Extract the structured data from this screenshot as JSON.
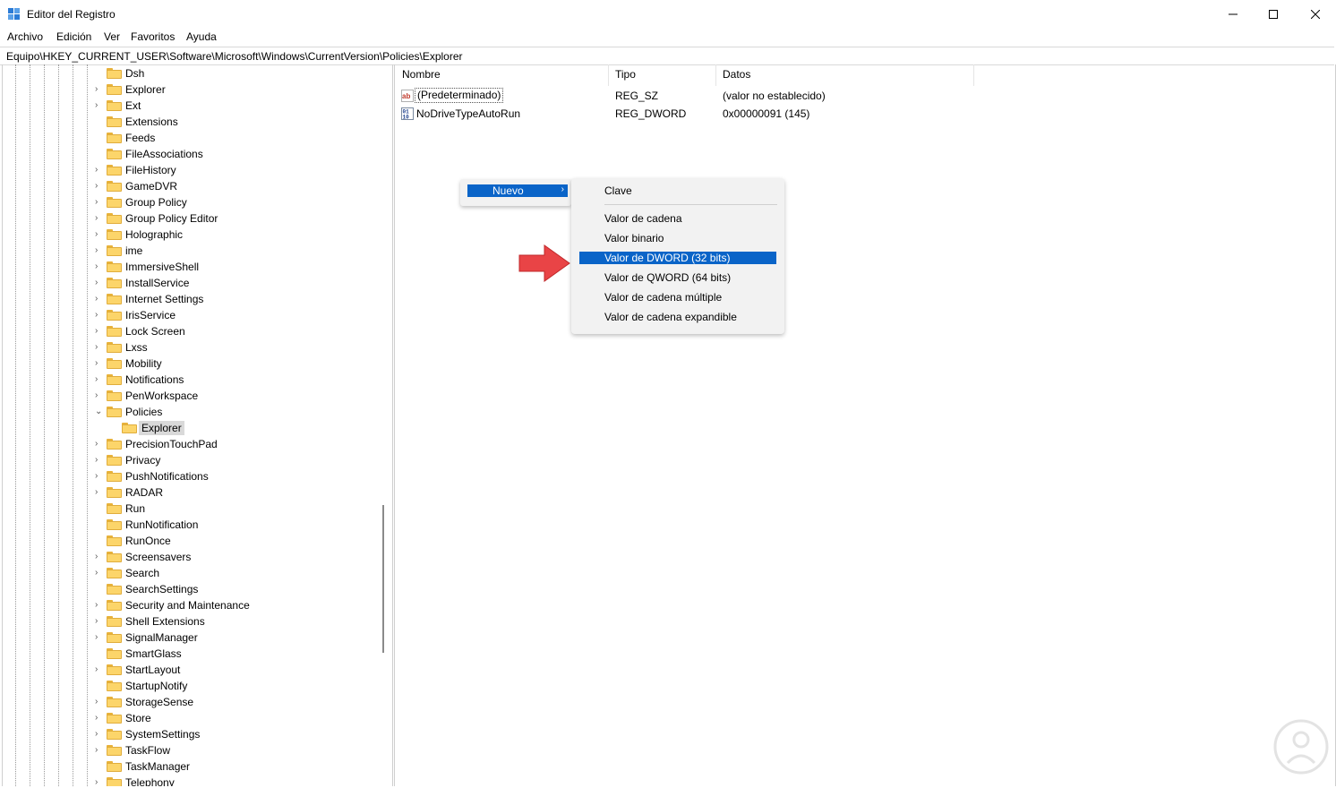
{
  "window": {
    "title": "Editor del Registro",
    "minimize": "—",
    "maximize": "☐",
    "close": "✕"
  },
  "menu": [
    "Archivo",
    "Edición",
    "Ver",
    "Favoritos",
    "Ayuda"
  ],
  "address": "Equipo\\HKEY_CURRENT_USER\\Software\\Microsoft\\Windows\\CurrentVersion\\Policies\\Explorer",
  "tree": [
    {
      "label": "Dsh",
      "expander": ""
    },
    {
      "label": "Explorer",
      "expander": "›"
    },
    {
      "label": "Ext",
      "expander": "›"
    },
    {
      "label": "Extensions",
      "expander": ""
    },
    {
      "label": "Feeds",
      "expander": ""
    },
    {
      "label": "FileAssociations",
      "expander": ""
    },
    {
      "label": "FileHistory",
      "expander": "›"
    },
    {
      "label": "GameDVR",
      "expander": "›"
    },
    {
      "label": "Group Policy",
      "expander": "›"
    },
    {
      "label": "Group Policy Editor",
      "expander": "›"
    },
    {
      "label": "Holographic",
      "expander": "›"
    },
    {
      "label": "ime",
      "expander": "›"
    },
    {
      "label": "ImmersiveShell",
      "expander": "›"
    },
    {
      "label": "InstallService",
      "expander": "›"
    },
    {
      "label": "Internet Settings",
      "expander": "›"
    },
    {
      "label": "IrisService",
      "expander": "›"
    },
    {
      "label": "Lock Screen",
      "expander": "›"
    },
    {
      "label": "Lxss",
      "expander": "›"
    },
    {
      "label": "Mobility",
      "expander": "›"
    },
    {
      "label": "Notifications",
      "expander": "›"
    },
    {
      "label": "PenWorkspace",
      "expander": "›"
    },
    {
      "label": "Policies",
      "expander": "⌄"
    },
    {
      "label": "Explorer",
      "expander": "",
      "child": true
    },
    {
      "label": "PrecisionTouchPad",
      "expander": "›"
    },
    {
      "label": "Privacy",
      "expander": "›"
    },
    {
      "label": "PushNotifications",
      "expander": "›"
    },
    {
      "label": "RADAR",
      "expander": "›"
    },
    {
      "label": "Run",
      "expander": ""
    },
    {
      "label": "RunNotification",
      "expander": ""
    },
    {
      "label": "RunOnce",
      "expander": ""
    },
    {
      "label": "Screensavers",
      "expander": "›"
    },
    {
      "label": "Search",
      "expander": "›"
    },
    {
      "label": "SearchSettings",
      "expander": ""
    },
    {
      "label": "Security and Maintenance",
      "expander": "›"
    },
    {
      "label": "Shell Extensions",
      "expander": "›"
    },
    {
      "label": "SignalManager",
      "expander": "›"
    },
    {
      "label": "SmartGlass",
      "expander": ""
    },
    {
      "label": "StartLayout",
      "expander": "›"
    },
    {
      "label": "StartupNotify",
      "expander": ""
    },
    {
      "label": "StorageSense",
      "expander": "›"
    },
    {
      "label": "Store",
      "expander": "›"
    },
    {
      "label": "SystemSettings",
      "expander": "›"
    },
    {
      "label": "TaskFlow",
      "expander": "›"
    },
    {
      "label": "TaskManager",
      "expander": ""
    },
    {
      "label": "Telephony",
      "expander": "›"
    }
  ],
  "list": {
    "headers": {
      "name": "Nombre",
      "type": "Tipo",
      "data": "Datos"
    },
    "rows": [
      {
        "name": "(Predeterminado)",
        "type": "REG_SZ",
        "data": "(valor no establecido)",
        "icon": "string-value-icon"
      },
      {
        "name": "NoDriveTypeAutoRun",
        "type": "REG_DWORD",
        "data": "0x00000091 (145)",
        "icon": "binary-value-icon"
      }
    ]
  },
  "context_menu": {
    "nuevo": "Nuevo",
    "arrow": "›"
  },
  "submenu": {
    "clave": "Clave",
    "items": [
      "Valor de cadena",
      "Valor binario",
      "Valor de DWORD (32 bits)",
      "Valor de QWORD (64 bits)",
      "Valor de cadena múltiple",
      "Valor de cadena expandible"
    ],
    "highlighted_index": 2
  },
  "colors": {
    "highlight": "#0a64c8",
    "folder": "#fcd56a",
    "arrow": "#e94446"
  }
}
